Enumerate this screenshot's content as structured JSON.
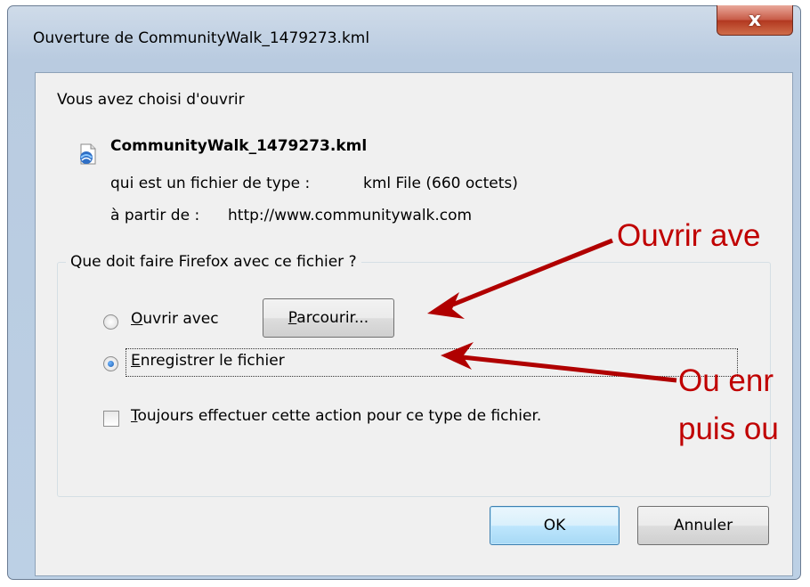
{
  "window": {
    "title": "Ouverture de CommunityWalk_1479273.kml",
    "close_glyph": "x"
  },
  "intro": "Vous avez choisi d'ouvrir",
  "file": {
    "icon": "kml-file-icon",
    "name": "CommunityWalk_1479273.kml",
    "type_label": "qui est un fichier de type :",
    "type_value": "kml File (660 octets)",
    "from_label": "à partir de :",
    "from_value": "http://www.communitywalk.com"
  },
  "group": {
    "label": "Que doit faire Firefox avec ce fichier ?",
    "open_with": {
      "accel": "O",
      "rest": "uvrir avec",
      "checked": false
    },
    "browse_button": {
      "accel": "P",
      "rest": "arcourir..."
    },
    "save": {
      "accel": "E",
      "rest": "nregistrer le fichier",
      "checked": true
    },
    "always": {
      "accel": "T",
      "rest": "oujours effectuer cette action pour ce type de fichier.",
      "checked": false
    }
  },
  "buttons": {
    "ok": "OK",
    "cancel": "Annuler"
  },
  "annotations": {
    "a1": "Ouvrir ave",
    "a2_line1": "Ou enr",
    "a2_line2": "puis ou",
    "color": "#c00000"
  }
}
